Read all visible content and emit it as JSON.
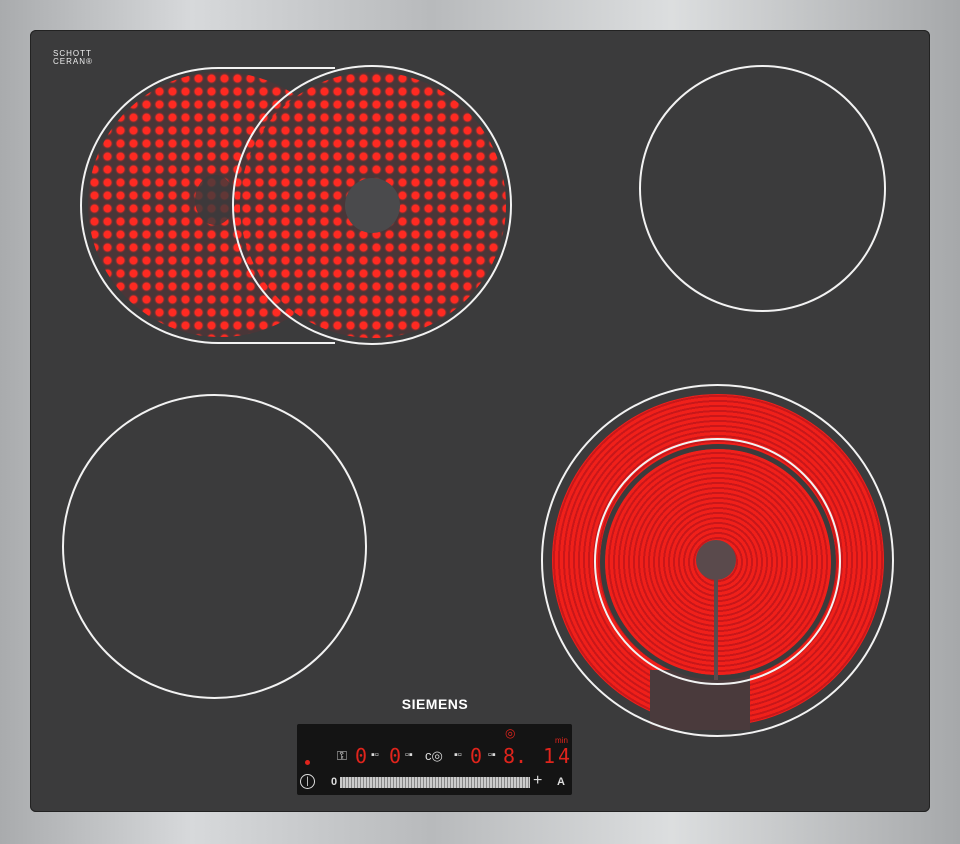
{
  "logo": {
    "line1": "SCHOTT",
    "line2": "CERAN®"
  },
  "brand": "SIEMENS",
  "colors": {
    "glass": "#3b3b3c",
    "heat": "#f0201a",
    "display": "#e0241c",
    "frame": "#c8cacc"
  },
  "zones": [
    {
      "name": "front-left dual",
      "state": "on"
    },
    {
      "name": "back-right",
      "state": "off"
    },
    {
      "name": "back-left",
      "state": "off"
    },
    {
      "name": "front-right dual",
      "state": "on"
    }
  ],
  "panel": {
    "power_icon": "power-icon",
    "zone_levels": [
      "0",
      "0",
      "0"
    ],
    "timer_digit": "8.",
    "timer_unit": "min",
    "timer_value": "14",
    "slider_min": "0",
    "plus": "+",
    "auto": "A"
  }
}
